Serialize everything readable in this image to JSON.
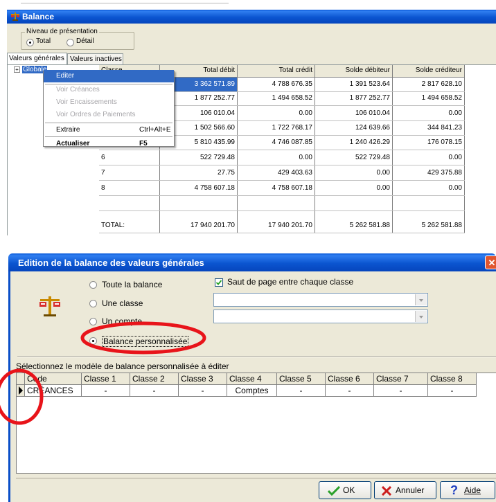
{
  "top_window": {
    "title": "Balance",
    "group_label": "Niveau de présentation",
    "radios": [
      {
        "label": "Total",
        "selected": true
      },
      {
        "label": "Détail",
        "selected": false
      }
    ],
    "tabs": [
      {
        "label": "Valeurs générales",
        "active": true
      },
      {
        "label": "Valeurs inactives",
        "active": false
      }
    ],
    "tree_root": "Globale",
    "tree_expander": "+",
    "table": {
      "headers": [
        "Classe",
        "Total débit",
        "Total crédit",
        "Solde débiteur",
        "Solde créditeur"
      ],
      "rows": [
        {
          "classe": "",
          "debit": "3 362 571.89",
          "credit": "4 788 676.35",
          "solde_deb": "1 391 523.64",
          "solde_cred": "2 817 628.10"
        },
        {
          "classe": "",
          "debit": "1 877 252.77",
          "credit": "1 494 658.52",
          "solde_deb": "1 877 252.77",
          "solde_cred": "1 494 658.52"
        },
        {
          "classe": "",
          "debit": "106 010.04",
          "credit": "0.00",
          "solde_deb": "106 010.04",
          "solde_cred": "0.00"
        },
        {
          "classe": "",
          "debit": "1 502 566.60",
          "credit": "1 722 768.17",
          "solde_deb": "124 639.66",
          "solde_cred": "344 841.23"
        },
        {
          "classe": "",
          "debit": "5 810 435.99",
          "credit": "4 746 087.85",
          "solde_deb": "1 240 426.29",
          "solde_cred": "176 078.15"
        },
        {
          "classe": "6",
          "debit": "522 729.48",
          "credit": "0.00",
          "solde_deb": "522 729.48",
          "solde_cred": "0.00"
        },
        {
          "classe": "7",
          "debit": "27.75",
          "credit": "429 403.63",
          "solde_deb": "0.00",
          "solde_cred": "429 375.88"
        },
        {
          "classe": "8",
          "debit": "4 758 607.18",
          "credit": "4 758 607.18",
          "solde_deb": "0.00",
          "solde_cred": "0.00"
        },
        {
          "classe": "",
          "debit": "",
          "credit": "",
          "solde_deb": "",
          "solde_cred": ""
        },
        {
          "classe": "TOTAL:",
          "debit": "17 940 201.70",
          "credit": "17 940 201.70",
          "solde_deb": "5 262 581.88",
          "solde_cred": "5 262 581.88"
        }
      ]
    },
    "context_menu": {
      "items": [
        {
          "label": "Editer",
          "shortcut": "",
          "state": "highlighted"
        },
        {
          "label": "Voir Créances",
          "shortcut": "",
          "state": "disabled"
        },
        {
          "label": "Voir Encaissements",
          "shortcut": "",
          "state": "disabled"
        },
        {
          "label": "Voir Ordres de Paiements",
          "shortcut": "",
          "state": "disabled"
        },
        {
          "label": "Extraire",
          "shortcut": "Ctrl+Alt+E",
          "state": "normal"
        },
        {
          "label": "Actualiser",
          "shortcut": "F5",
          "state": "bold"
        }
      ]
    }
  },
  "dialog": {
    "title": "Edition de la balance des valeurs générales",
    "close_glyph": "✕",
    "options": [
      {
        "label": "Toute la balance",
        "selected": false
      },
      {
        "label": "Une classe",
        "selected": false
      },
      {
        "label": "Un compte",
        "selected": false
      },
      {
        "label": "Balance personnalisée",
        "selected": true
      }
    ],
    "checkbox": {
      "label": "Saut de page entre chaque classe",
      "checked": true
    },
    "combo1_value": "",
    "combo2_value": "",
    "model_label": "Sélectionnez le modèle de balance personnalisée à éditer",
    "grid": {
      "headers": [
        "Code",
        "Classe 1",
        "Classe 2",
        "Classe 3",
        "Classe 4",
        "Classe 5",
        "Classe 6",
        "Classe 7",
        "Classe 8"
      ],
      "rows": [
        [
          "CRÉANCES",
          "-",
          "-",
          "-",
          "Comptes",
          "-",
          "-",
          "-",
          "-"
        ]
      ]
    },
    "buttons": {
      "ok": "OK",
      "cancel": "Annuler",
      "help": "Aide"
    },
    "colors": {
      "ok_check": "#2aa02a",
      "cancel_x": "#cc1f1f",
      "help_q": "#1f3fbf",
      "annotation": "#e8141a"
    }
  }
}
